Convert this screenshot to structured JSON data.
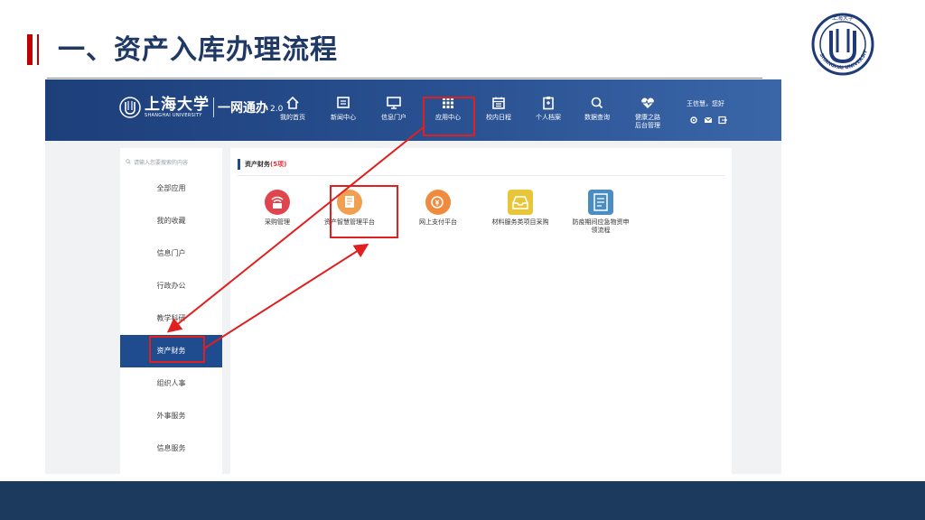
{
  "slide": {
    "title": "一、资产入库办理流程",
    "accent_color": "#c00000",
    "title_color": "#1f3864",
    "footer_color": "#1c3a5e",
    "logo_icon": "shanghai-university-seal-icon",
    "logo_text": "SHANGHAI UNIVERSITY"
  },
  "portal": {
    "brand_cn": "上海大学",
    "brand_en": "SHANGHAI UNIVERSITY",
    "product": "一网通办",
    "version": "2.0",
    "nav": [
      {
        "label": "我的首页",
        "icon": "home-icon"
      },
      {
        "label": "新闻中心",
        "icon": "news-icon"
      },
      {
        "label": "信息门户",
        "icon": "monitor-icon"
      },
      {
        "label": "应用中心",
        "icon": "grid-icon"
      },
      {
        "label": "校内日程",
        "icon": "calendar-icon"
      },
      {
        "label": "个人档案",
        "icon": "clipboard-icon"
      },
      {
        "label": "数据查询",
        "icon": "search-icon"
      },
      {
        "label": "健康之路",
        "label2": "后台管理",
        "icon": "heart-pulse-icon"
      }
    ],
    "user_greeting": "王信慧，您好"
  },
  "sidebar": {
    "search_placeholder": "请输入您要搜索的内容",
    "items": [
      {
        "label": "全部应用"
      },
      {
        "label": "我的收藏"
      },
      {
        "label": "信息门户"
      },
      {
        "label": "行政办公"
      },
      {
        "label": "教学科研"
      },
      {
        "label": "资产财务"
      },
      {
        "label": "组织人事"
      },
      {
        "label": "外事服务"
      },
      {
        "label": "信息服务"
      }
    ],
    "active_color": "#1f4c8f"
  },
  "main": {
    "section_title": "资产财务",
    "section_count": "(5项)",
    "apps": [
      {
        "label": "采购管理",
        "color": "#e0444c",
        "icon": "wifi-card-icon"
      },
      {
        "label": "资产智慧管理平台",
        "color": "#f0a050",
        "icon": "document-icon"
      },
      {
        "label": "网上支付平台",
        "color": "#f08a3c",
        "icon": "payment-icon"
      },
      {
        "label": "材料服务类项目采购",
        "color": "#e8c63a",
        "icon": "inbox-icon"
      },
      {
        "label": "防疫期间应急物资申",
        "label2": "领流程",
        "color": "#4a8dc2",
        "icon": "form-list-icon"
      }
    ]
  },
  "annotations": {
    "color": "#e02020"
  }
}
